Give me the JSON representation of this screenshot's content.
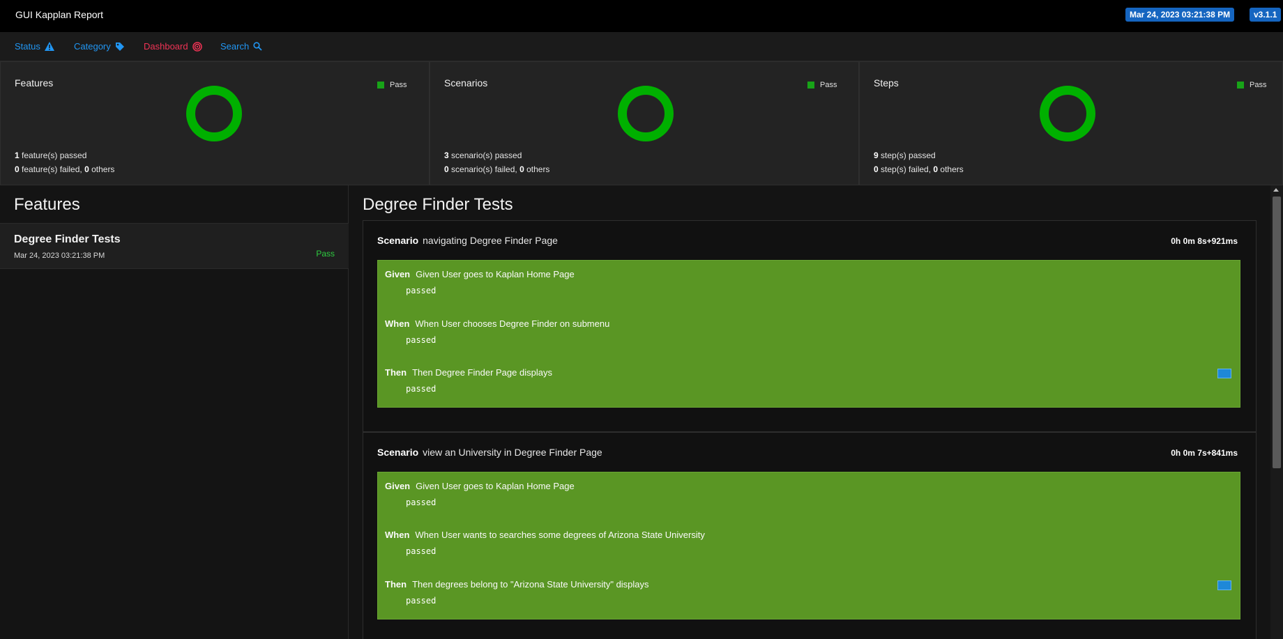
{
  "header": {
    "title": "GUI Kapplan Report",
    "date_badge": "Mar 24, 2023 03:21:38 PM",
    "version_badge": "v3.1.1"
  },
  "nav": {
    "status": "Status",
    "category": "Category",
    "dashboard": "Dashboard",
    "search": "Search"
  },
  "stats": {
    "features": {
      "title": "Features",
      "legend": "Pass",
      "passed_count": "1",
      "passed_label": " feature(s) passed",
      "failed_count": "0",
      "failed_label": " feature(s) failed, ",
      "others_count": "0",
      "others_label": " others"
    },
    "scenarios": {
      "title": "Scenarios",
      "legend": "Pass",
      "passed_count": "3",
      "passed_label": " scenario(s) passed",
      "failed_count": "0",
      "failed_label": " scenario(s) failed, ",
      "others_count": "0",
      "others_label": " others"
    },
    "steps": {
      "title": "Steps",
      "legend": "Pass",
      "passed_count": "9",
      "passed_label": " step(s) passed",
      "failed_count": "0",
      "failed_label": " step(s) failed, ",
      "others_count": "0",
      "others_label": " others"
    }
  },
  "features_panel": {
    "heading": "Features",
    "items": [
      {
        "name": "Degree Finder Tests",
        "date": "Mar 24, 2023 03:21:38 PM",
        "status": "Pass"
      }
    ]
  },
  "detail": {
    "heading": "Degree Finder Tests",
    "scenarios": [
      {
        "keyword": "Scenario",
        "name": "navigating Degree Finder Page",
        "duration": "0h 0m 8s+921ms",
        "steps": [
          {
            "keyword": "Given",
            "text": "Given User goes to Kaplan Home Page",
            "result": "passed"
          },
          {
            "keyword": "When",
            "text": "When User chooses Degree Finder on submenu",
            "result": "passed"
          },
          {
            "keyword": "Then",
            "text": "Then Degree Finder Page displays",
            "result": "passed"
          }
        ]
      },
      {
        "keyword": "Scenario",
        "name": "view an University in Degree Finder Page",
        "duration": "0h 0m 7s+841ms",
        "steps": [
          {
            "keyword": "Given",
            "text": "Given User goes to Kaplan Home Page",
            "result": "passed"
          },
          {
            "keyword": "When",
            "text": "When User wants to searches some degrees of Arizona State University",
            "result": "passed"
          },
          {
            "keyword": "Then",
            "text": "Then degrees belong to \"Arizona State University\" displays",
            "result": "passed"
          }
        ]
      }
    ]
  },
  "icons": {
    "status": "warning-triangle-icon",
    "category": "tag-icon",
    "dashboard": "dashboard-spiral-icon",
    "search": "search-icon",
    "screenshot": "image-icon"
  },
  "colors": {
    "accent_blue": "#2196f3",
    "dashboard_red": "#f03355",
    "pass_green": "#00b000",
    "step_box_green": "#5a9624",
    "badge_blue": "#1565c0"
  }
}
